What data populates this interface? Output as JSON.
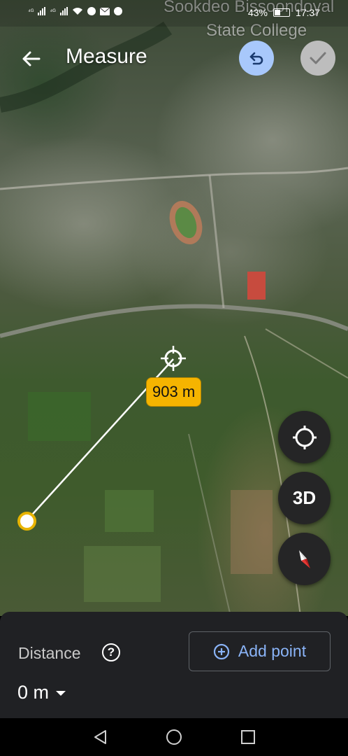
{
  "status_bar": {
    "network_left": "⁴ᴳ",
    "network_right": "⁴ᴳ",
    "battery": "43%",
    "battery_level": 0.43,
    "time": "17:37"
  },
  "map": {
    "place_label_line1": "Sookdeo Bissoondoyal",
    "place_label_line2": "State College"
  },
  "header": {
    "title": "Measure",
    "back_icon": "arrow-back-icon",
    "undo_icon": "undo-icon",
    "done_icon": "check-icon"
  },
  "measurement": {
    "segment_label": "903 m"
  },
  "controls": {
    "locate_icon": "my-location-icon",
    "view_3d_label": "3D",
    "compass_icon": "compass-icon"
  },
  "panel": {
    "distance_label": "Distance",
    "help_symbol": "?",
    "add_point_label": "Add point",
    "distance_value": "0 m"
  },
  "colors": {
    "accent_blue": "#8ab4f8",
    "undo_bg": "#a8c8fb",
    "chip_yellow": "#f5b400",
    "panel_bg": "#202124",
    "fab_bg": "#252526"
  },
  "nav": {
    "back": "back-triangle-icon",
    "home": "home-circle-icon",
    "recents": "recents-square-icon"
  }
}
